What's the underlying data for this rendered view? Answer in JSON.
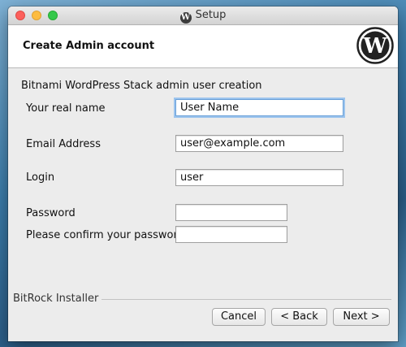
{
  "window": {
    "title": "Setup"
  },
  "header": {
    "title": "Create Admin account"
  },
  "form": {
    "subtitle": "Bitnami WordPress Stack admin user creation",
    "fields": [
      {
        "label": "Your real name",
        "value": "User Name"
      },
      {
        "label": "Email Address",
        "value": "user@example.com"
      },
      {
        "label": "Login",
        "value": "user"
      },
      {
        "label": "Password",
        "value": ""
      },
      {
        "label": "Please confirm your password",
        "value": ""
      }
    ]
  },
  "footer": {
    "installer_label": "BitRock Installer",
    "buttons": {
      "cancel": "Cancel",
      "back": "< Back",
      "next": "Next >"
    }
  },
  "icons": {
    "logo": "wordpress-logo-icon"
  },
  "colors": {
    "close": "#fc605c",
    "minimize": "#fdbc40",
    "maximize": "#34c84a",
    "focus": "#6aa0d8"
  }
}
